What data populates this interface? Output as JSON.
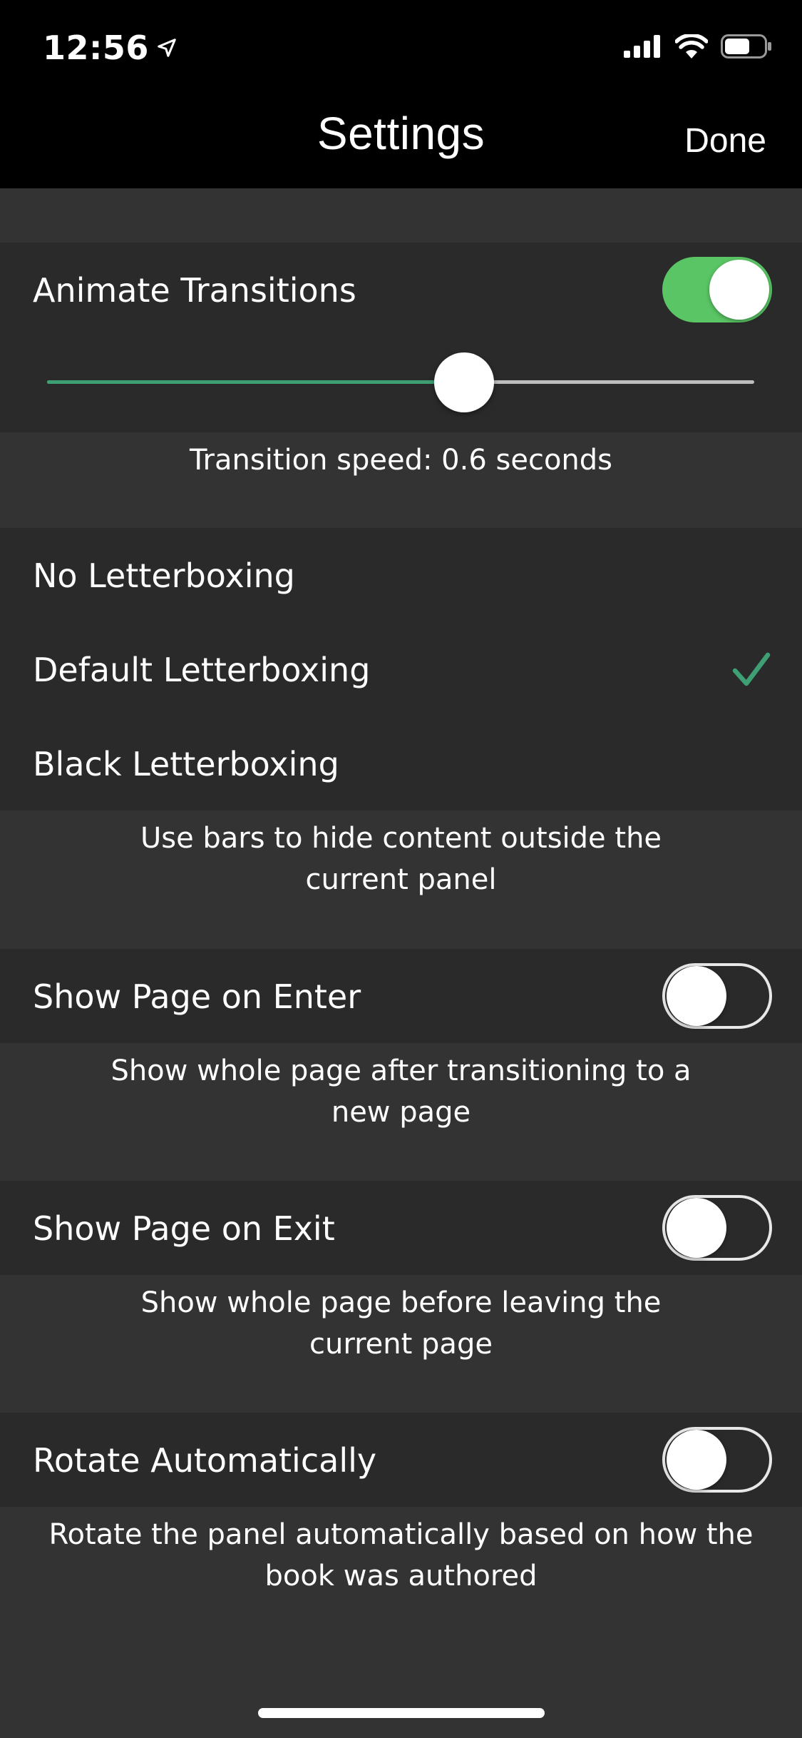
{
  "status_bar": {
    "time": "12:56",
    "location_icon": "location-arrow-icon",
    "signal_icon": "cellular-signal-icon",
    "wifi_icon": "wifi-icon",
    "battery_icon": "battery-icon"
  },
  "nav": {
    "title": "Settings",
    "done_label": "Done"
  },
  "transitions": {
    "animate_label": "Animate Transitions",
    "animate_on": true,
    "speed_fraction": 0.59,
    "speed_footer": "Transition speed: 0.6 seconds"
  },
  "letterboxing": {
    "options": [
      {
        "label": "No Letterboxing",
        "selected": false
      },
      {
        "label": "Default Letterboxing",
        "selected": true
      },
      {
        "label": "Black Letterboxing",
        "selected": false
      }
    ],
    "footer_line1": "Use bars to hide content outside the",
    "footer_line2": "current panel"
  },
  "show_page_on_enter": {
    "label": "Show Page on Enter",
    "on": false,
    "footer_line1": "Show whole page after transitioning to a",
    "footer_line2": "new page"
  },
  "show_page_on_exit": {
    "label": "Show Page on Exit",
    "on": false,
    "footer_line1": "Show whole page before leaving the",
    "footer_line2": "current page"
  },
  "rotate_automatically": {
    "label": "Rotate Automatically",
    "on": false,
    "footer_line1": "Rotate the panel automatically based on how the",
    "footer_line2": "book was authored"
  },
  "colors": {
    "accent_green": "#5ac564",
    "slider_fill": "#3f9f74",
    "checkmark": "#3f9f74",
    "cell_background": "#2a2a2a",
    "group_background": "#333333",
    "bar_background": "#000000"
  }
}
